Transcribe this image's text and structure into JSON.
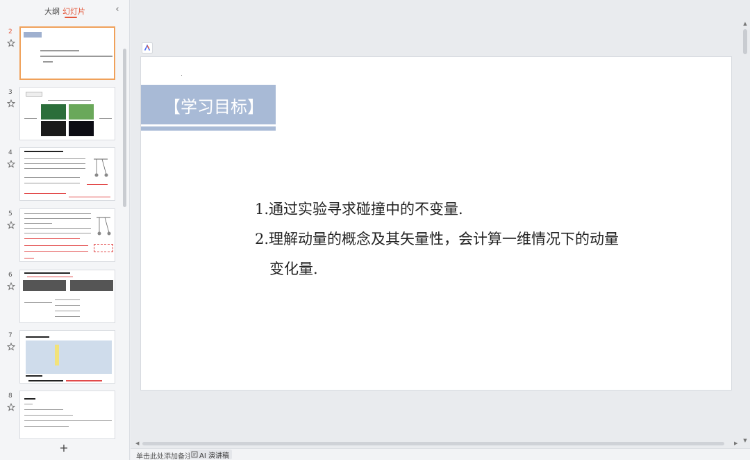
{
  "panel": {
    "tabs": {
      "outline": "大纲",
      "slides": "幻灯片"
    },
    "thumbnails": [
      {
        "num": "2",
        "active": true
      },
      {
        "num": "3",
        "active": false
      },
      {
        "num": "4",
        "active": false
      },
      {
        "num": "5",
        "active": false
      },
      {
        "num": "6",
        "active": false
      },
      {
        "num": "7",
        "active": false
      },
      {
        "num": "8",
        "active": false
      }
    ],
    "add_label": "+"
  },
  "slide": {
    "title": "【学习目标】",
    "objectives": [
      "1.通过实验寻求碰撞中的不变量.",
      "2.理解动量的概念及其矢量性，会计算一维情况下的动量",
      "变化量."
    ]
  },
  "notes": {
    "placeholder": "单击此处添加备注",
    "ai_label": "AI 演讲稿"
  },
  "colors": {
    "accent": "#e4573a",
    "title_band": "#a8bad6",
    "active_thumb_border": "#f0a15a"
  }
}
